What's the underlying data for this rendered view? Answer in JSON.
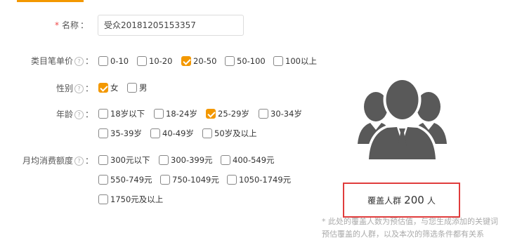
{
  "form": {
    "name": {
      "required_mark": "*",
      "label": "名称",
      "colon": "：",
      "value": "受众20181205153357"
    },
    "category_price": {
      "label": "类目笔单价",
      "help": "?",
      "colon": "：",
      "options": [
        {
          "label": "0-10",
          "checked": false
        },
        {
          "label": "10-20",
          "checked": false
        },
        {
          "label": "20-50",
          "checked": true
        },
        {
          "label": "50-100",
          "checked": false
        },
        {
          "label": "100以上",
          "checked": false
        }
      ]
    },
    "gender": {
      "label": "性别",
      "help": "?",
      "colon": "：",
      "options": [
        {
          "label": "女",
          "checked": true
        },
        {
          "label": "男",
          "checked": false
        }
      ]
    },
    "age": {
      "label": "年龄",
      "help": "?",
      "colon": "：",
      "options": [
        {
          "label": "18岁以下",
          "checked": false
        },
        {
          "label": "18-24岁",
          "checked": false
        },
        {
          "label": "25-29岁",
          "checked": true
        },
        {
          "label": "30-34岁",
          "checked": false
        },
        {
          "label": "35-39岁",
          "checked": false
        },
        {
          "label": "40-49岁",
          "checked": false
        },
        {
          "label": "50岁及以上",
          "checked": false
        }
      ]
    },
    "monthly_spend": {
      "label": "月均消费额度",
      "help": "?",
      "colon": "：",
      "options": [
        {
          "label": "300元以下",
          "checked": false
        },
        {
          "label": "300-399元",
          "checked": false
        },
        {
          "label": "400-549元",
          "checked": false
        },
        {
          "label": "550-749元",
          "checked": false
        },
        {
          "label": "750-1049元",
          "checked": false
        },
        {
          "label": "1050-1749元",
          "checked": false
        },
        {
          "label": "1750元及以上",
          "checked": false
        }
      ]
    }
  },
  "coverage": {
    "prefix": "覆盖人群",
    "count": "200",
    "suffix": "人",
    "note": "* 此处的覆盖人数为预估值，与您生成添加的关键词预估覆盖的人群，以及本次的筛选条件都有关系"
  },
  "colors": {
    "accent": "#f39800",
    "highlight_border": "#e03c3c",
    "icon": "#595959"
  },
  "icons": {
    "people": "people-group-icon",
    "help": "question-circle-icon"
  }
}
